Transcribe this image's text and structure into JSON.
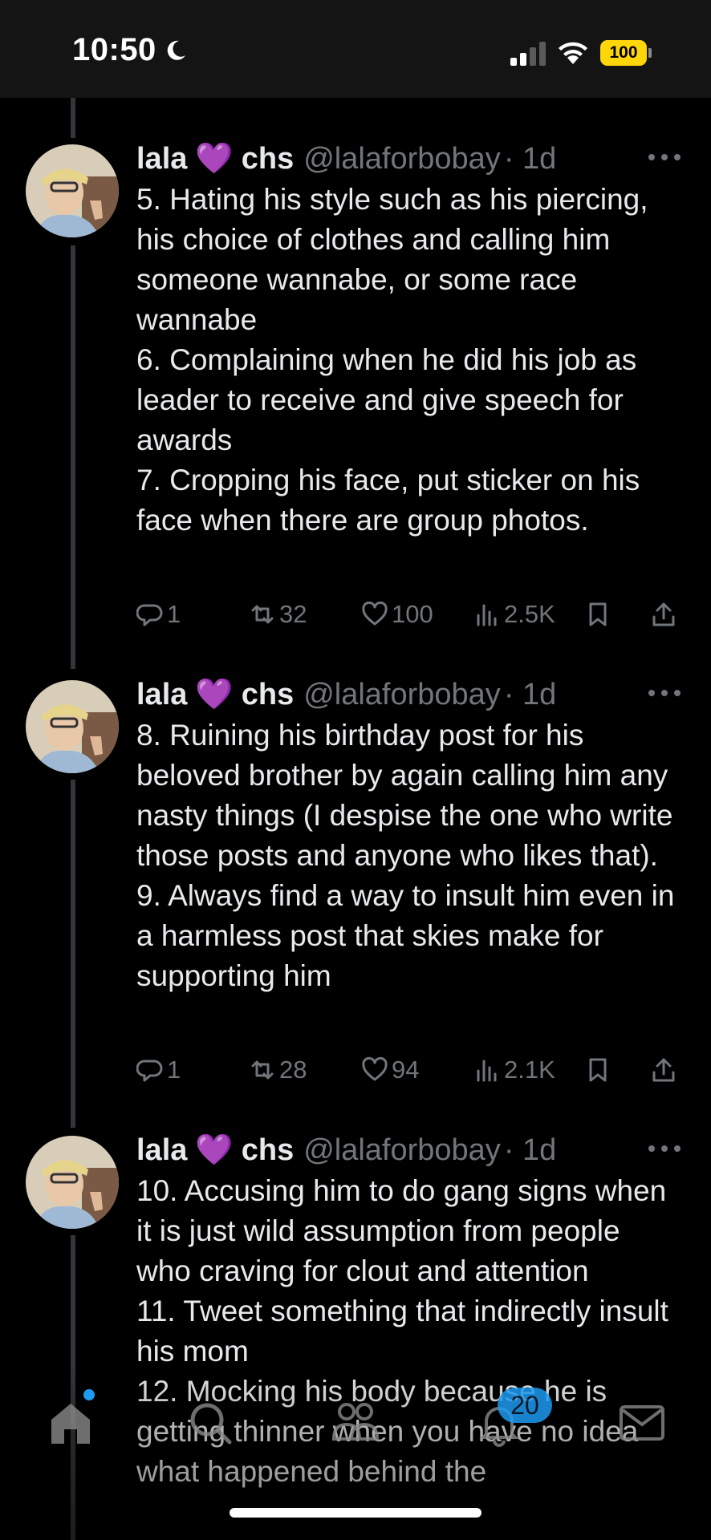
{
  "status_bar": {
    "time": "10:50",
    "battery_level": "100",
    "colors": {
      "battery": "#ffd60a"
    }
  },
  "tweets": [
    {
      "name": "lala",
      "emoji": "💜",
      "name_suffix": "chs",
      "handle": "@lalaforbobay",
      "time": "· 1d",
      "text": "5. Hating his style such as his piercing, his choice of clothes and calling him someone wannabe, or some race wannabe\n6. Complaining when he did his job as leader to receive and give speech for awards\n7. Cropping his face, put sticker on his face when there are group photos.",
      "replies": "1",
      "reposts": "32",
      "likes": "100",
      "views": "2.5K"
    },
    {
      "name": "lala",
      "emoji": "💜",
      "name_suffix": "chs",
      "handle": "@lalaforbobay",
      "time": "· 1d",
      "text": "8. Ruining his birthday post for his beloved brother by again calling him any nasty things (I despise the one who write those posts and anyone who likes that).\n9. Always find a way to insult him even in a harmless post that skies make for supporting him",
      "replies": "1",
      "reposts": "28",
      "likes": "94",
      "views": "2.1K"
    },
    {
      "name": "lala",
      "emoji": "💜",
      "name_suffix": "chs",
      "handle": "@lalaforbobay",
      "time": "· 1d",
      "text": "10. Accusing him to do gang signs when it is just wild assumption from people who craving for clout and attention\n11. Tweet something that indirectly insult his mom\n12. Mocking his body because he is getting thinner when you have no idea what happened behind the"
    }
  ],
  "tab_bar": {
    "notifications_badge": "20",
    "icons": [
      "home-icon",
      "search-icon",
      "communities-icon",
      "notifications-icon",
      "messages-icon"
    ],
    "colors": {
      "accent": "#1d9bf0"
    }
  }
}
